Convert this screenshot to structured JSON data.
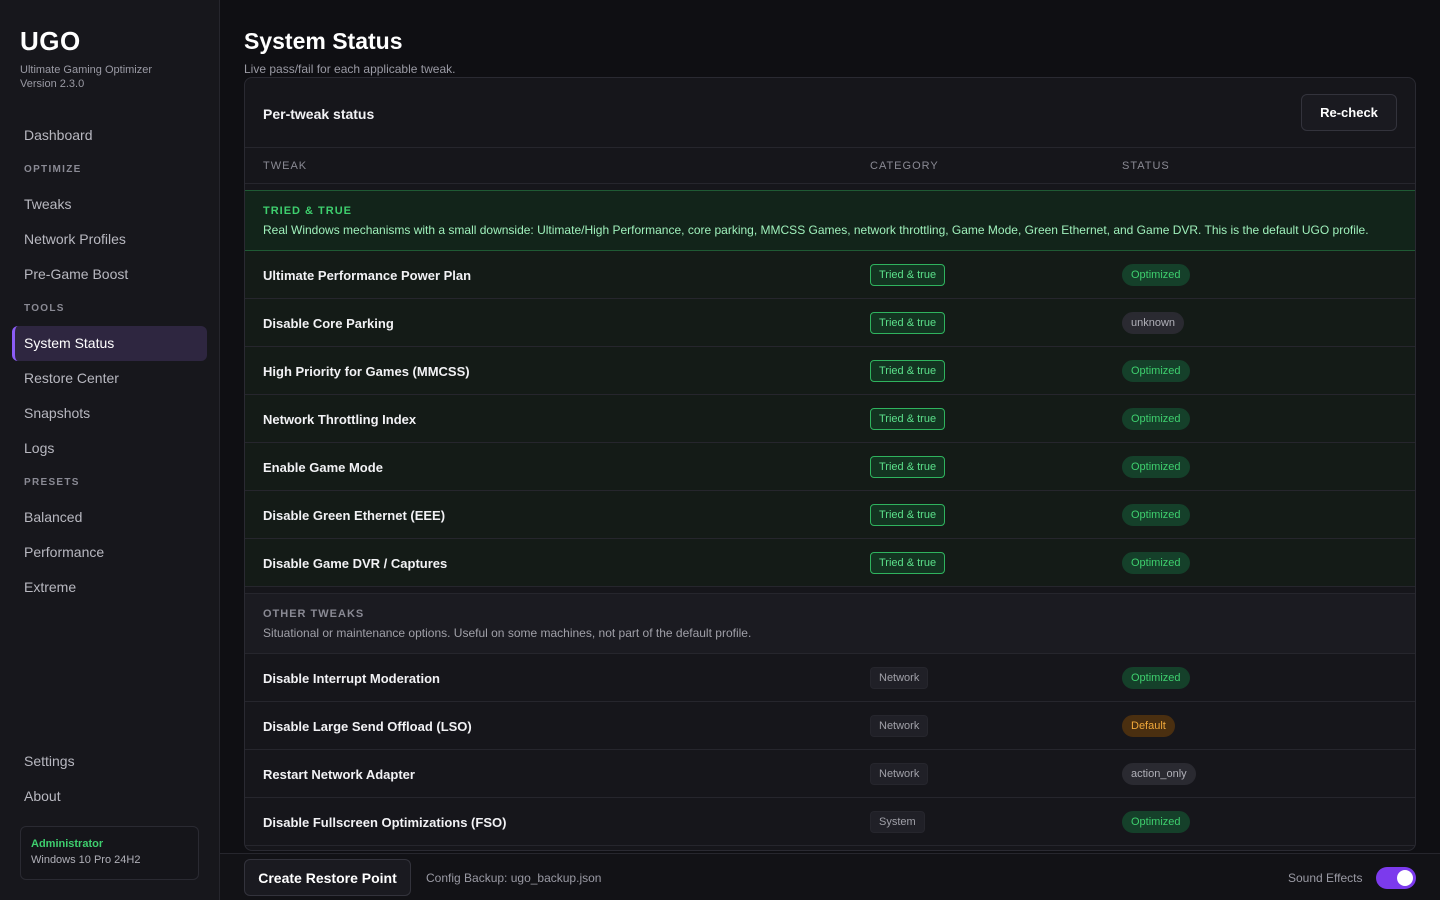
{
  "brand": {
    "logo": "UGO",
    "subtitle": "Ultimate Gaming Optimizer",
    "version": "Version 2.3.0"
  },
  "nav": {
    "dashboard": "Dashboard",
    "optimize_heading": "OPTIMIZE",
    "tweaks": "Tweaks",
    "network_profiles": "Network Profiles",
    "pregame_boost": "Pre-Game Boost",
    "tools_heading": "TOOLS",
    "system_status": "System Status",
    "restore_center": "Restore Center",
    "snapshots": "Snapshots",
    "logs": "Logs",
    "presets_heading": "PRESETS",
    "balanced": "Balanced",
    "performance": "Performance",
    "extreme": "Extreme",
    "settings": "Settings",
    "about": "About"
  },
  "user": {
    "role": "Administrator",
    "os": "Windows 10 Pro 24H2"
  },
  "page": {
    "title": "System Status",
    "subtitle": "Live pass/fail for each applicable tweak."
  },
  "card": {
    "title": "Per-tweak status",
    "recheck_label": "Re-check",
    "columns": {
      "tweak": "TWEAK",
      "category": "CATEGORY",
      "status": "STATUS"
    }
  },
  "groups": {
    "tried": {
      "title": "TRIED & TRUE",
      "description": "Real Windows mechanisms with a small downside: Ultimate/High Performance, core parking, MMCSS Games, network throttling, Game Mode, Green Ethernet, and Game DVR. This is the default UGO profile.",
      "rows": [
        {
          "name": "Ultimate Performance Power Plan",
          "category": "Tried & true",
          "status": "Optimized"
        },
        {
          "name": "Disable Core Parking",
          "category": "Tried & true",
          "status": "unknown"
        },
        {
          "name": "High Priority for Games (MMCSS)",
          "category": "Tried & true",
          "status": "Optimized"
        },
        {
          "name": "Network Throttling Index",
          "category": "Tried & true",
          "status": "Optimized"
        },
        {
          "name": "Enable Game Mode",
          "category": "Tried & true",
          "status": "Optimized"
        },
        {
          "name": "Disable Green Ethernet (EEE)",
          "category": "Tried & true",
          "status": "Optimized"
        },
        {
          "name": "Disable Game DVR / Captures",
          "category": "Tried & true",
          "status": "Optimized"
        }
      ]
    },
    "other": {
      "title": "OTHER TWEAKS",
      "description": "Situational or maintenance options. Useful on some machines, not part of the default profile.",
      "rows": [
        {
          "name": "Disable Interrupt Moderation",
          "category": "Network",
          "status": "Optimized"
        },
        {
          "name": "Disable Large Send Offload (LSO)",
          "category": "Network",
          "status": "Default"
        },
        {
          "name": "Restart Network Adapter",
          "category": "Network",
          "status": "action_only"
        },
        {
          "name": "Disable Fullscreen Optimizations (FSO)",
          "category": "System",
          "status": "Optimized"
        }
      ]
    }
  },
  "bottombar": {
    "restore_label": "Create Restore Point",
    "backup_text": "Config Backup: ugo_backup.json",
    "sound_label": "Sound Effects",
    "sound_enabled": true
  },
  "colors": {
    "accent": "#7c3aed",
    "optimized": "#3ecf6e",
    "default": "#f0a83a"
  }
}
